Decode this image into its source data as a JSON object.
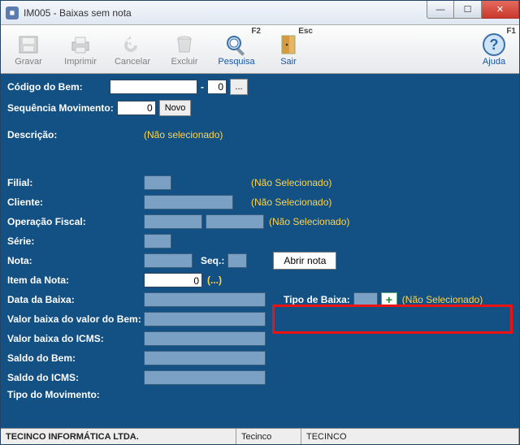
{
  "window": {
    "title": "IM005 - Baixas sem nota"
  },
  "toolbar": {
    "gravar": "Gravar",
    "imprimir": "Imprimir",
    "cancelar": "Cancelar",
    "excluir": "Excluir",
    "pesquisa": "Pesquisa",
    "pesquisa_hotkey": "F2",
    "sair": "Sair",
    "sair_hotkey": "Esc",
    "ajuda": "Ajuda",
    "ajuda_hotkey": "F1"
  },
  "top": {
    "codigo_bem_label": "Código do Bem:",
    "codigo_bem_value": "",
    "codigo_bem_sub": "0",
    "lookup_btn": "...",
    "seq_mov_label": "Sequência Movimento:",
    "seq_mov_value": "0",
    "novo_btn": "Novo"
  },
  "desc": {
    "label": "Descrição:",
    "value": "(Não selecionado)"
  },
  "fields": {
    "filial_label": "Filial:",
    "filial_nsel": "(Não Selecionado)",
    "cliente_label": "Cliente:",
    "cliente_nsel": "(Não Selecionado)",
    "opfiscal_label": "Operação Fiscal:",
    "opfiscal_nsel": "(Não Selecionado)",
    "serie_label": "Série:",
    "nota_label": "Nota:",
    "nota_seq_label": "Seq.:",
    "abrir_nota_btn": "Abrir nota",
    "item_nota_label": "Item da Nota:",
    "item_nota_value": "0",
    "item_nota_lookup": "(...)",
    "data_baixa_label": "Data da Baixa:",
    "tipo_baixa_label": "Tipo de Baixa:",
    "tipo_baixa_nsel": "(Não Selecionado)",
    "valor_baixa_bem_label": "Valor baixa do valor do Bem:",
    "valor_baixa_icms_label": "Valor baixa do ICMS:",
    "saldo_bem_label": "Saldo do Bem:",
    "saldo_icms_label": "Saldo do ICMS:",
    "tipo_mov_label": "Tipo do Movimento:"
  },
  "status": {
    "company": "TECINCO INFORMÁTICA LTDA.",
    "short": "Tecinco",
    "caps": "TECINCO"
  }
}
